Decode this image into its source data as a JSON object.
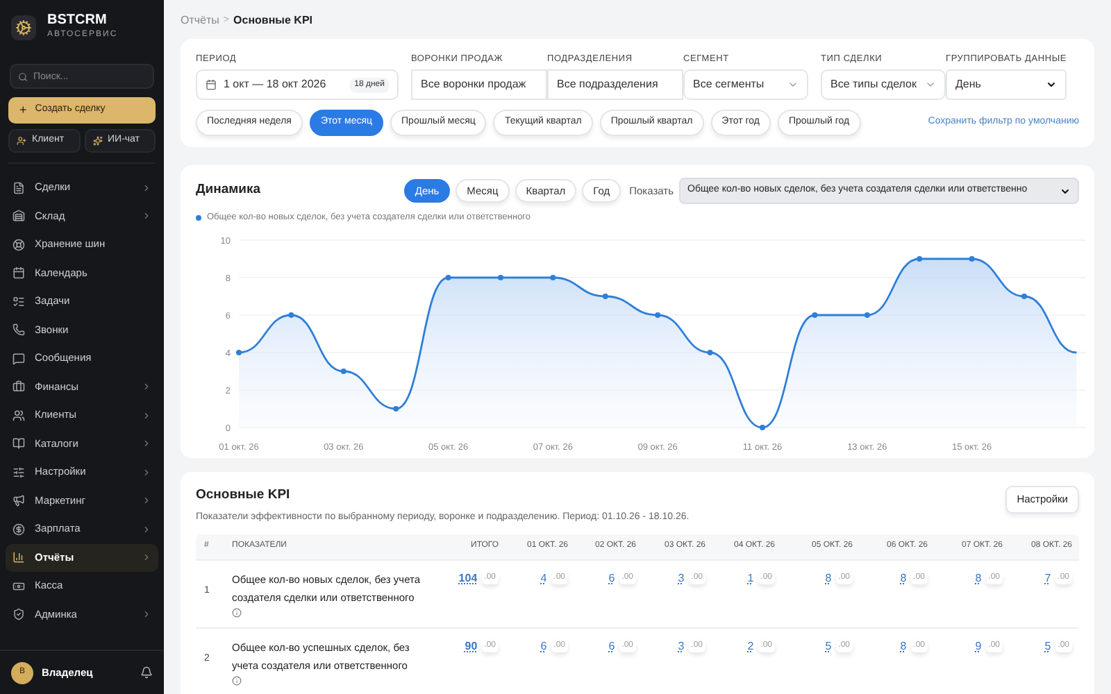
{
  "sidebar": {
    "brand": {
      "name": "BSTCRM",
      "subtitle": "АВТОСЕРВИС"
    },
    "search": {
      "placeholder": "Поиск..."
    },
    "create_button": {
      "icon": "+",
      "label": "Создать сделку"
    },
    "quick_buttons": [
      "Клиент",
      "ИИ-чат"
    ],
    "items": [
      {
        "label": "Сделки",
        "has_submenu": true,
        "selected": false
      },
      {
        "label": "Склад",
        "has_submenu": true,
        "selected": false
      },
      {
        "label": "Хранение шин",
        "has_submenu": false,
        "selected": false
      },
      {
        "label": "Календарь",
        "has_submenu": false,
        "selected": false
      },
      {
        "label": "Задачи",
        "has_submenu": false,
        "selected": false
      },
      {
        "label": "Звонки",
        "has_submenu": false,
        "selected": false
      },
      {
        "label": "Сообщения",
        "has_submenu": false,
        "selected": false
      },
      {
        "label": "Финансы",
        "has_submenu": true,
        "selected": false
      },
      {
        "label": "Клиенты",
        "has_submenu": true,
        "selected": false
      },
      {
        "label": "Каталоги",
        "has_submenu": true,
        "selected": false
      },
      {
        "label": "Настройки",
        "has_submenu": true,
        "selected": false
      },
      {
        "label": "Маркетинг",
        "has_submenu": true,
        "selected": false
      },
      {
        "label": "Зарплата",
        "has_submenu": true,
        "selected": false
      },
      {
        "label": "Отчёты",
        "has_submenu": true,
        "selected": true
      },
      {
        "label": "Касса",
        "has_submenu": false,
        "selected": false
      },
      {
        "label": "Админка",
        "has_submenu": true,
        "selected": false
      }
    ],
    "user": {
      "initial": "В",
      "name": "Владелец"
    }
  },
  "breadcrumb": {
    "parent": "Отчёты",
    "separator": ">",
    "current": "Основные KPI"
  },
  "filters": {
    "fields": [
      {
        "kind": "date",
        "label": "ПЕРИОД",
        "value": "1 окт — 18 окт 2026",
        "badge": "18 дней"
      },
      {
        "kind": "text",
        "label": "ВОРОНКИ ПРОДАЖ",
        "value": "Все воронки продаж"
      },
      {
        "kind": "text",
        "label": "ПОДРАЗДЕЛЕНИЯ",
        "value": "Все подразделения"
      },
      {
        "kind": "dropdown",
        "label": "СЕГМЕНТ",
        "value": "Все сегменты"
      },
      {
        "kind": "dropdown",
        "label": "ТИП СДЕЛКИ",
        "value": "Все типы сделок"
      },
      {
        "kind": "select",
        "label": "ГРУППИРОВАТЬ ДАННЫЕ",
        "value": "День"
      }
    ],
    "presets": [
      {
        "label": "Последняя неделя",
        "selected": false
      },
      {
        "label": "Этот месяц",
        "selected": true
      },
      {
        "label": "Прошлый месяц",
        "selected": false
      },
      {
        "label": "Текущий квартал",
        "selected": false
      },
      {
        "label": "Прошлый квартал",
        "selected": false
      },
      {
        "label": "Этот год",
        "selected": false
      },
      {
        "label": "Прошлый год",
        "selected": false
      }
    ],
    "save_link": "Сохранить фильтр по умолчанию"
  },
  "dynamics": {
    "title": "Динамика",
    "tabs": [
      {
        "label": "День",
        "selected": true
      },
      {
        "label": "Месяц",
        "selected": false
      },
      {
        "label": "Квартал",
        "selected": false
      },
      {
        "label": "Год",
        "selected": false
      }
    ],
    "show_label": "Показать",
    "show_select": "Общее кол-во новых сделок, без учета создателя сделки или ответственно",
    "chart_data": {
      "type": "area",
      "categories": [
        "01 окт. 26",
        null,
        "03 окт. 26",
        null,
        "05 окт. 26",
        null,
        "07 окт. 26",
        null,
        "09 окт. 26",
        null,
        "11 окт. 26",
        null,
        "13 окт. 26",
        null,
        "15 окт. 26",
        null,
        null
      ],
      "ylim": [
        0,
        10
      ],
      "yticks": [
        0,
        2,
        4,
        6,
        8,
        10
      ],
      "grid": true,
      "series": [
        {
          "name": "Общее кол-во новых сделок, без учета создателя сделки или ответственного",
          "color": "#2f7fd8",
          "values": [
            4,
            6,
            3,
            1,
            8,
            8,
            8,
            7,
            6,
            4,
            0,
            6,
            6,
            9,
            9,
            7,
            4
          ]
        }
      ]
    }
  },
  "kpi": {
    "title": "Основные KPI",
    "subtitle": "Показатели эффективности по выбранному периоду, воронке и подразделению. Период: 01.10.26 - 18.10.26.",
    "settings_button": "Настройки",
    "columns": [
      "#",
      "ПОКАЗАТЕЛИ",
      "ИТОГО",
      "01 ОКТ. 26",
      "02 ОКТ. 26",
      "03 ОКТ. 26",
      "04 ОКТ. 26",
      "05 ОКТ. 26",
      "06 ОКТ. 26",
      "07 ОКТ. 26",
      "08 ОКТ. 26"
    ],
    "rows": [
      {
        "index": "1",
        "name": "Общее кол-во новых сделок, без учета создателя сделки или ответственного",
        "values": [
          {
            "value": "104",
            "cents": ".00"
          },
          {
            "value": "4",
            "cents": ".00"
          },
          {
            "value": "6",
            "cents": ".00"
          },
          {
            "value": "3",
            "cents": ".00"
          },
          {
            "value": "1",
            "cents": ".00"
          },
          {
            "value": "8",
            "cents": ".00"
          },
          {
            "value": "8",
            "cents": ".00"
          },
          {
            "value": "8",
            "cents": ".00"
          },
          {
            "value": "7",
            "cents": ".00"
          }
        ]
      },
      {
        "index": "2",
        "name": "Общее кол-во успешных сделок, без учета создателя или ответственного",
        "values": [
          {
            "value": "90",
            "cents": ".00"
          },
          {
            "value": "6",
            "cents": ".00"
          },
          {
            "value": "6",
            "cents": ".00"
          },
          {
            "value": "3",
            "cents": ".00"
          },
          {
            "value": "2",
            "cents": ".00"
          },
          {
            "value": "5",
            "cents": ".00"
          },
          {
            "value": "8",
            "cents": ".00"
          },
          {
            "value": "9",
            "cents": ".00"
          },
          {
            "value": "5",
            "cents": ".00"
          }
        ]
      }
    ]
  }
}
